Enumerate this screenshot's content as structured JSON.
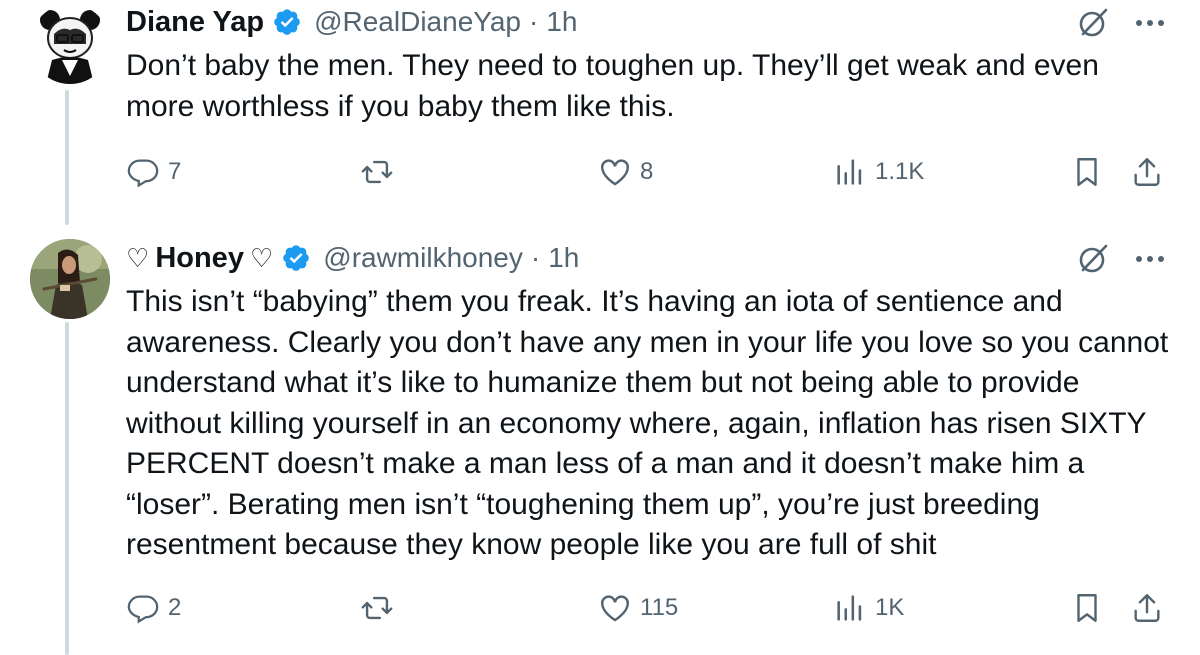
{
  "tweets": [
    {
      "name": "Diane Yap",
      "handle": "@RealDianeYap",
      "separator": "·",
      "time": "1h",
      "text": "Don’t baby the men. They need to toughen up. They’ll get weak and even more worthless if you baby them like this.",
      "replies": "7",
      "retweets": "",
      "likes": "8",
      "views": "1.1K"
    },
    {
      "name": "Honey",
      "name_prefix_icon": "♡",
      "name_suffix_icon": "♡",
      "handle": "@rawmilkhoney",
      "separator": "·",
      "time": "1h",
      "text": "This isn’t “babying” them you freak. It’s having an iota of sentience and awareness. Clearly you don’t have any men in your life you love so you cannot understand what it’s like to humanize them but not being able to provide without killing yourself in an economy where, again, inflation has risen SIXTY PERCENT doesn’t make a man less of a man and it doesn’t make him a “loser”. Berating men isn’t “toughening them up”, you’re just breeding resentment because they know people like you are full of shit",
      "replies": "2",
      "retweets": "",
      "likes": "115",
      "views": "1K"
    }
  ],
  "colors": {
    "verified": "#1d9bf0",
    "text": "#0f1419",
    "secondary": "#536471",
    "thread_line": "#cfd9de"
  }
}
